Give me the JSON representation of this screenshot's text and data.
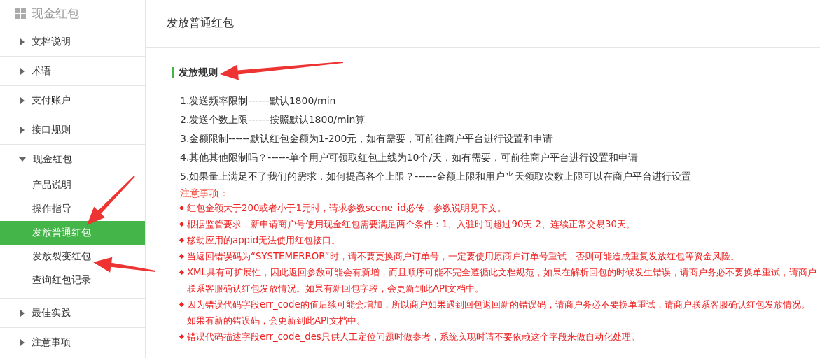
{
  "sidebar": {
    "title": "现金红包",
    "items": [
      {
        "label": "文档说明",
        "expanded": false
      },
      {
        "label": "术语",
        "expanded": false
      },
      {
        "label": "支付账户",
        "expanded": false
      },
      {
        "label": "接口规则",
        "expanded": false
      },
      {
        "label": "现金红包",
        "expanded": true,
        "children": [
          {
            "label": "产品说明",
            "selected": false
          },
          {
            "label": "操作指导",
            "selected": false
          },
          {
            "label": "发放普通红包",
            "selected": true
          },
          {
            "label": "发放裂变红包",
            "selected": false
          },
          {
            "label": "查询红包记录",
            "selected": false
          }
        ]
      },
      {
        "label": "最佳实践",
        "expanded": false
      },
      {
        "label": "注意事项",
        "expanded": false
      }
    ]
  },
  "page": {
    "title": "发放普通红包",
    "section_title": "发放规则",
    "rules": [
      "1.发送频率限制------默认1800/min",
      "2.发送个数上限------按照默认1800/min算",
      "3.金额限制------默认红包金额为1-200元，如有需要，可前往商户平台进行设置和申请",
      "4.其他其他限制吗？------单个用户可领取红包上线为10个/天，如有需要，可前往商户平台进行设置和申请",
      "5.如果量上满足不了我们的需求，如何提高各个上限？------金额上限和用户当天领取次数上限可以在商户平台进行设置"
    ],
    "notes_title": "注意事项：",
    "notes": [
      "红包金额大于200或者小于1元时，请求参数scene_id必传，参数说明见下文。",
      "根据监管要求，新申请商户号使用现金红包需要满足两个条件：1、入驻时间超过90天 2、连续正常交易30天。",
      "移动应用的appid无法使用红包接口。",
      "当返回错误码为“SYSTEMERROR”时，请不要更换商户订单号，一定要使用原商户订单号重试，否则可能造成重复发放红包等资金风险。",
      "XML具有可扩展性，因此返回参数可能会有新增，而且顺序可能不完全遵循此文档规范，如果在解析回包的时候发生错误，请商户务必不要换单重试，请商户联系客服确认红包发放情况。如果有新回包字段，会更新到此API文档中。",
      "因为错误代码字段err_code的值后续可能会增加，所以商户如果遇到回包返回新的错误码，请商户务必不要换单重试，请商户联系客服确认红包发放情况。如果有新的错误码，会更新到此API文档中。",
      "错误代码描述字段err_code_des只供人工定位问题时做参考，系统实现时请不要依赖这个字段来做自动化处理。"
    ]
  }
}
